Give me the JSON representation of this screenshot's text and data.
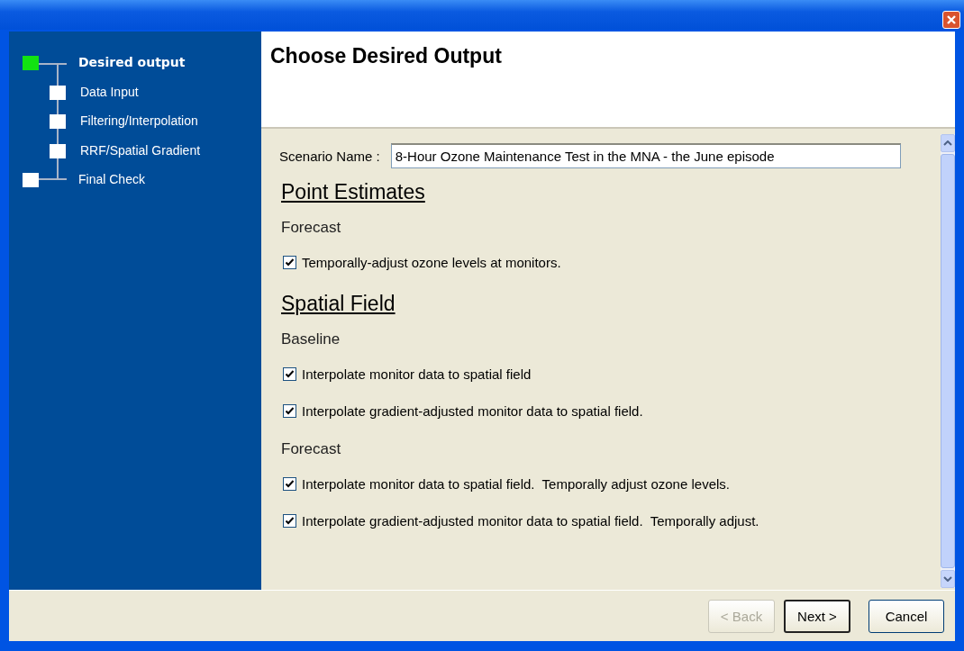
{
  "steps": [
    {
      "label": "Desired output",
      "selected": true,
      "children": [
        {
          "label": "Data Input",
          "selected": false
        },
        {
          "label": "Filtering/Interpolation",
          "selected": false
        },
        {
          "label": "RRF/Spatial Gradient",
          "selected": false
        }
      ]
    },
    {
      "label": "Final Check",
      "selected": false
    }
  ],
  "page_title": "Choose Desired Output",
  "scenario": {
    "label": "Scenario Name :",
    "value": "8-Hour Ozone Maintenance Test in the MNA - the June episode"
  },
  "sections": [
    {
      "heading": "Point Estimates",
      "groups": [
        {
          "label": "Forecast",
          "options": [
            {
              "label": "Temporally-adjust ozone levels at monitors.",
              "checked": true
            }
          ]
        }
      ]
    },
    {
      "heading": "Spatial Field",
      "groups": [
        {
          "label": "Baseline",
          "options": [
            {
              "label": "Interpolate monitor data to spatial field",
              "checked": true
            },
            {
              "label": "Interpolate gradient-adjusted monitor data to spatial field.",
              "checked": true
            }
          ]
        },
        {
          "label": "Forecast",
          "options": [
            {
              "label": "Interpolate monitor data to spatial field.  Temporally adjust ozone levels.",
              "checked": true
            },
            {
              "label": "Interpolate gradient-adjusted monitor data to spatial field.  Temporally adjust.",
              "checked": true
            }
          ]
        }
      ]
    }
  ],
  "buttons": [
    {
      "label": "< Back",
      "disabled": true,
      "default": false
    },
    {
      "label": "Next >",
      "disabled": false,
      "default": true
    },
    {
      "label": "Cancel",
      "disabled": false,
      "default": false
    }
  ]
}
